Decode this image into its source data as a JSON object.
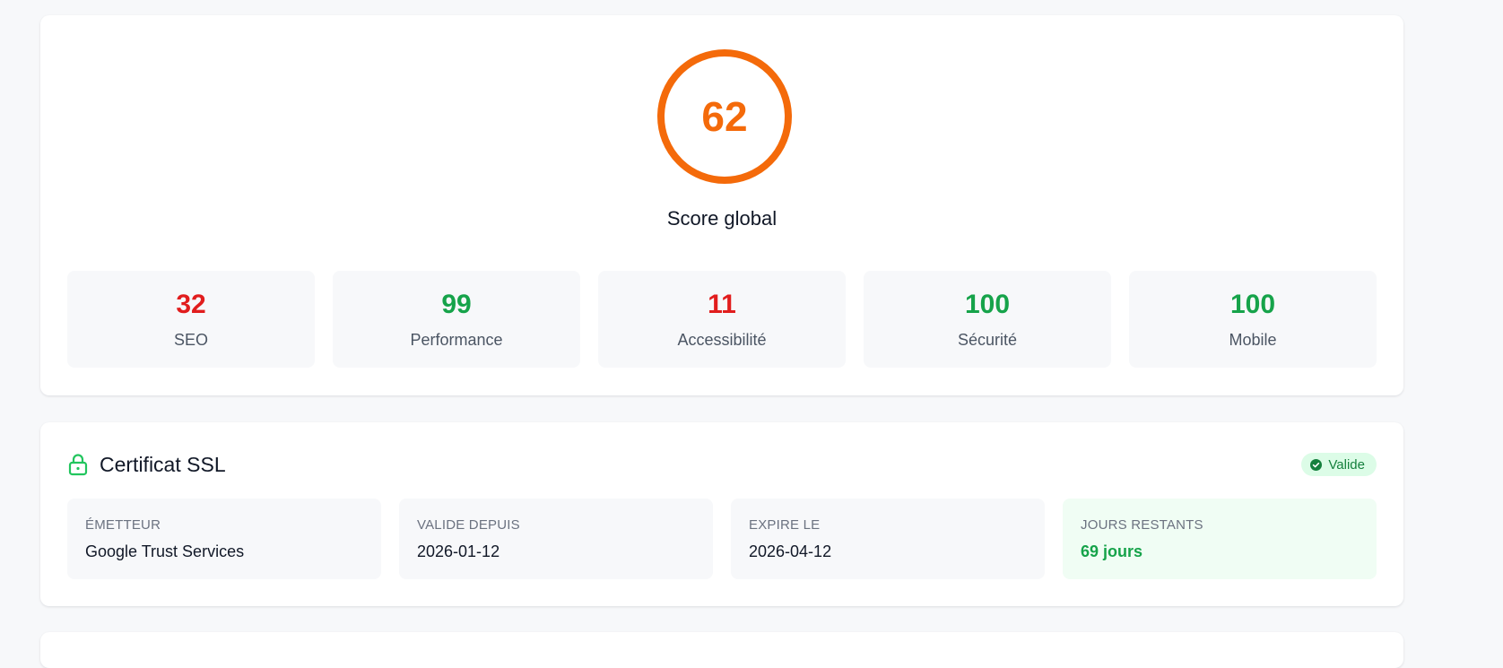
{
  "overview": {
    "global_score": "62",
    "global_score_fraction": 0.62,
    "global_label": "Score global",
    "colors": {
      "orange": "#f46a0a",
      "red": "#e11d1d",
      "green": "#16a34a"
    },
    "metrics": [
      {
        "value": "32",
        "label": "SEO",
        "status": "red"
      },
      {
        "value": "99",
        "label": "Performance",
        "status": "green"
      },
      {
        "value": "11",
        "label": "Accessibilité",
        "status": "red"
      },
      {
        "value": "100",
        "label": "Sécurité",
        "status": "green"
      },
      {
        "value": "100",
        "label": "Mobile",
        "status": "green"
      }
    ]
  },
  "ssl": {
    "title": "Certificat SSL",
    "icon": "lock-icon",
    "badge": "Valide",
    "badge_icon": "check-circle-icon",
    "fields": [
      {
        "label": "ÉMETTEUR",
        "value": "Google Trust Services"
      },
      {
        "label": "VALIDE DEPUIS",
        "value": "2026-01-12"
      },
      {
        "label": "EXPIRE LE",
        "value": "2026-04-12"
      },
      {
        "label": "JOURS RESTANTS",
        "value": "69 jours"
      }
    ]
  }
}
